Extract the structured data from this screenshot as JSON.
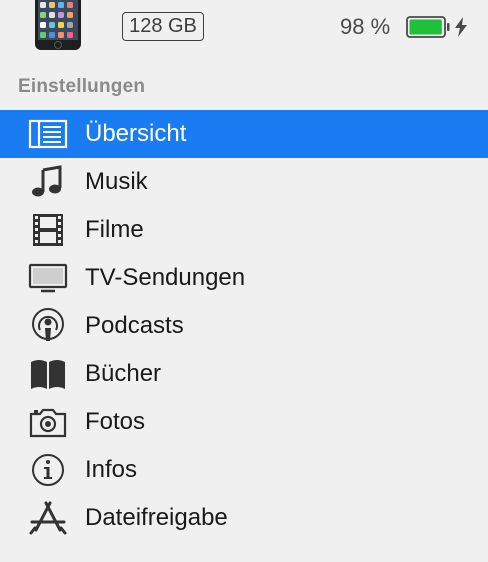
{
  "device": {
    "capacity": "128 GB",
    "battery_text": "98 %",
    "battery_level": 0.98,
    "charging": true
  },
  "sidebar": {
    "section_title": "Einstellungen",
    "selected_color": "#1a7cf2",
    "items": [
      {
        "label": "Übersicht",
        "icon": "summary-icon",
        "selected": true
      },
      {
        "label": "Musik",
        "icon": "music-note-icon",
        "selected": false
      },
      {
        "label": "Filme",
        "icon": "film-strip-icon",
        "selected": false
      },
      {
        "label": "TV-Sendungen",
        "icon": "tv-icon",
        "selected": false
      },
      {
        "label": "Podcasts",
        "icon": "podcast-icon",
        "selected": false
      },
      {
        "label": "Bücher",
        "icon": "book-icon",
        "selected": false
      },
      {
        "label": "Fotos",
        "icon": "camera-icon",
        "selected": false
      },
      {
        "label": "Infos",
        "icon": "info-icon",
        "selected": false
      },
      {
        "label": "Dateifreigabe",
        "icon": "app-store-icon",
        "selected": false
      }
    ]
  }
}
